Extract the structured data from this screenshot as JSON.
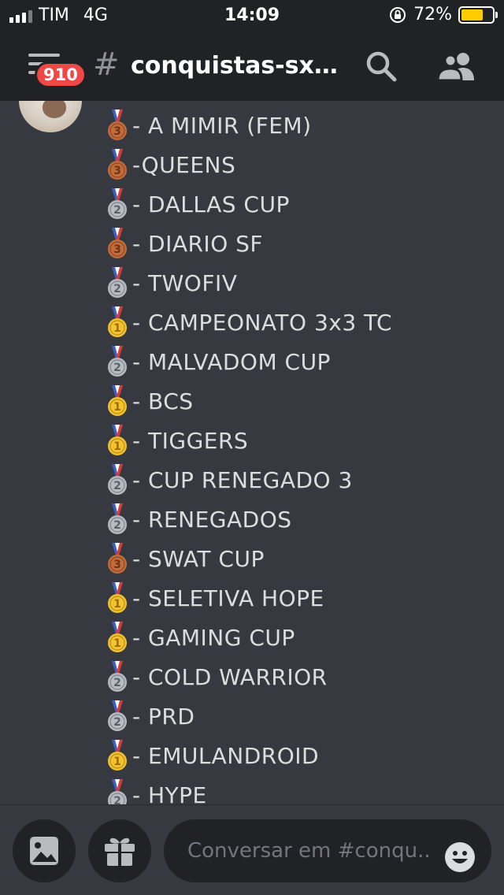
{
  "status": {
    "carrier": "TIM",
    "network": "4G",
    "time": "14:09",
    "battery_percent": "72%",
    "battery_level": 0.72,
    "icons": [
      "signal-icon",
      "orientation-lock-icon",
      "battery-icon"
    ]
  },
  "header": {
    "notification_badge": "910",
    "hash": "#",
    "channel_name": "conquistas-sx-...",
    "icons": [
      "menu-icon",
      "search-icon",
      "members-icon"
    ]
  },
  "colors": {
    "background": "#36393f",
    "header": "#202225",
    "badge": "#f04747",
    "gold": "#f2c230",
    "silver": "#b8bcc2",
    "bronze": "#c36b3a"
  },
  "messages": [
    {
      "medal": "bronze",
      "medal_number": "3",
      "text": " - A MIMIR (FEM)"
    },
    {
      "medal": "bronze",
      "medal_number": "3",
      "text": " -QUEENS"
    },
    {
      "medal": "silver",
      "medal_number": "2",
      "text": " - DALLAS CUP"
    },
    {
      "medal": "bronze",
      "medal_number": "3",
      "text": " - DIARIO SF"
    },
    {
      "medal": "silver",
      "medal_number": "2",
      "text": " - TWOFIV"
    },
    {
      "medal": "gold",
      "medal_number": "1",
      "text": " - CAMPEONATO 3x3 TC"
    },
    {
      "medal": "silver",
      "medal_number": "2",
      "text": " - MALVADOM CUP"
    },
    {
      "medal": "gold",
      "medal_number": "1",
      "text": " - BCS"
    },
    {
      "medal": "gold",
      "medal_number": "1",
      "text": " - TIGGERS"
    },
    {
      "medal": "silver",
      "medal_number": "2",
      "text": " - CUP RENEGADO 3"
    },
    {
      "medal": "silver",
      "medal_number": "2",
      "text": " - RENEGADOS"
    },
    {
      "medal": "bronze",
      "medal_number": "3",
      "text": " - SWAT CUP"
    },
    {
      "medal": "gold",
      "medal_number": "1",
      "text": " - SELETIVA HOPE"
    },
    {
      "medal": "gold",
      "medal_number": "1",
      "text": " - GAMING CUP"
    },
    {
      "medal": "silver",
      "medal_number": "2",
      "text": " - COLD WARRIOR"
    },
    {
      "medal": "silver",
      "medal_number": "2",
      "text": " - PRD"
    },
    {
      "medal": "gold",
      "medal_number": "1",
      "text": " - EMULANDROID"
    },
    {
      "medal": "silver",
      "medal_number": "2",
      "text": " - HYPE"
    }
  ],
  "composer": {
    "placeholder": "Conversar em #conqu..",
    "icons": [
      "image-icon",
      "gift-icon",
      "emoji-icon"
    ]
  }
}
